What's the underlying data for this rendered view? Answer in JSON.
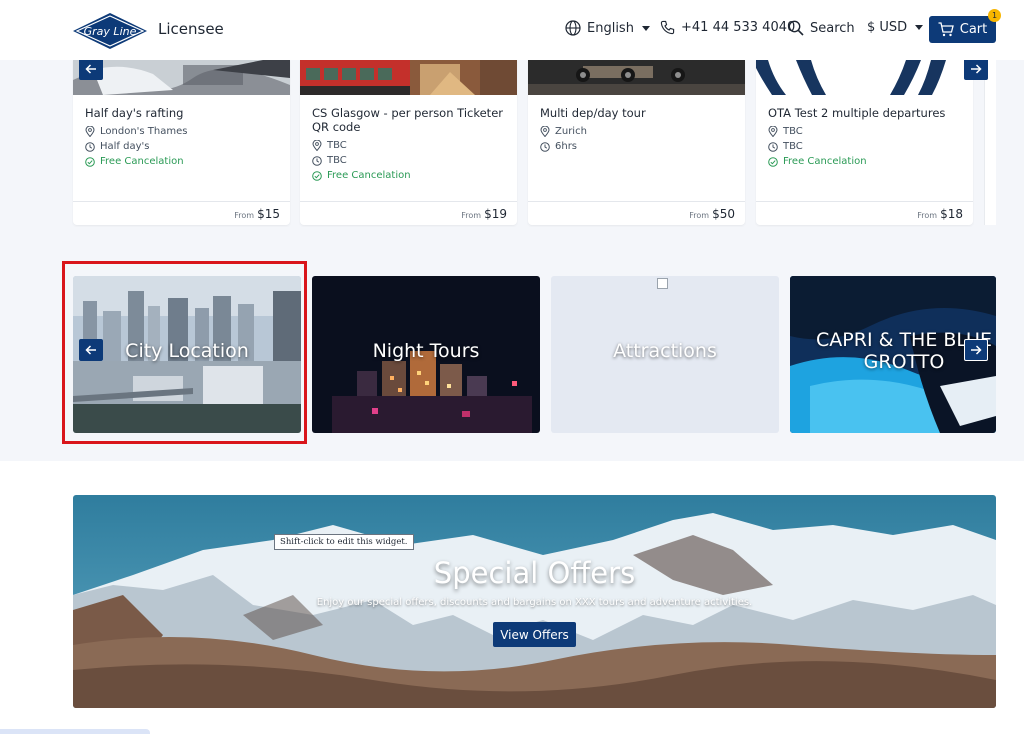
{
  "header": {
    "logo_text": "Gray Line",
    "brand": "Licensee",
    "language": "English",
    "phone": "+41 44 533 4040",
    "search": "Search",
    "currency": "$ USD",
    "cart": "Cart",
    "cart_count": "1"
  },
  "tours": [
    {
      "title": "Half day's rafting",
      "location": "London's Thames",
      "duration": "Half day's",
      "cancel": "Free Cancelation",
      "from": "From",
      "price": "$15"
    },
    {
      "title": "CS Glasgow - per person Ticketer QR code",
      "location": "TBC",
      "duration": "TBC",
      "cancel": "Free Cancelation",
      "from": "From",
      "price": "$19"
    },
    {
      "title": "Multi dep/day tour",
      "location": "Zurich",
      "duration": "6hrs",
      "from": "From",
      "price": "$50"
    },
    {
      "title": "OTA Test 2 multiple departures",
      "location": "TBC",
      "duration": "TBC",
      "cancel": "Free Cancelation",
      "from": "From",
      "price": "$18"
    }
  ],
  "categories": [
    {
      "label": "City Location"
    },
    {
      "label": "Night Tours"
    },
    {
      "label": "Attractions"
    },
    {
      "label_line1": "CAPRI & THE BLUE",
      "label_line2": "GROTTO"
    }
  ],
  "offers": {
    "title": "Special Offers",
    "subtitle": "Enjoy our special offers, discounts and bargains on XXX tours and adventure activities.",
    "button": "View Offers",
    "tooltip": "Shift-click to edit this widget."
  },
  "colors": {
    "primary": "#0d3a78",
    "badge": "#f7b500",
    "cancel_green": "#2a9a55",
    "highlight": "#d9151b"
  }
}
